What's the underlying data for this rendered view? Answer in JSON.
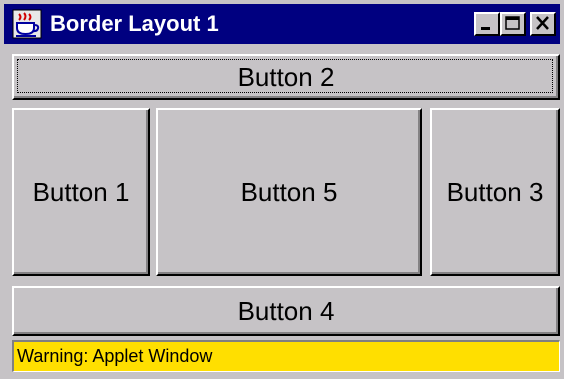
{
  "window": {
    "title": "Border Layout 1",
    "app_icon": "java-coffee-cup-icon",
    "controls": {
      "minimize_icon": "minimize-icon",
      "maximize_icon": "maximize-icon",
      "close_icon": "close-icon"
    }
  },
  "layout": {
    "north": {
      "label": "Button 2"
    },
    "west": {
      "label": "Button 1"
    },
    "center": {
      "label": "Button 5"
    },
    "east": {
      "label": "Button 3"
    },
    "south": {
      "label": "Button 4"
    }
  },
  "status": {
    "warning_text": "Warning: Applet Window"
  },
  "colors": {
    "titlebar": "#000080",
    "face": "#c6c3c6",
    "warning_background": "#ffdf00"
  }
}
